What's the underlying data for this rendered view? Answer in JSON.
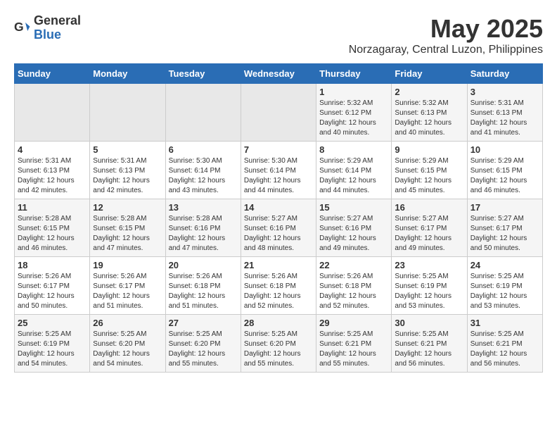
{
  "logo": {
    "general": "General",
    "blue": "Blue"
  },
  "title": "May 2025",
  "subtitle": "Norzagaray, Central Luzon, Philippines",
  "days_of_week": [
    "Sunday",
    "Monday",
    "Tuesday",
    "Wednesday",
    "Thursday",
    "Friday",
    "Saturday"
  ],
  "weeks": [
    [
      {
        "day": "",
        "info": ""
      },
      {
        "day": "",
        "info": ""
      },
      {
        "day": "",
        "info": ""
      },
      {
        "day": "",
        "info": ""
      },
      {
        "day": "1",
        "info": "Sunrise: 5:32 AM\nSunset: 6:12 PM\nDaylight: 12 hours\nand 40 minutes."
      },
      {
        "day": "2",
        "info": "Sunrise: 5:32 AM\nSunset: 6:13 PM\nDaylight: 12 hours\nand 40 minutes."
      },
      {
        "day": "3",
        "info": "Sunrise: 5:31 AM\nSunset: 6:13 PM\nDaylight: 12 hours\nand 41 minutes."
      }
    ],
    [
      {
        "day": "4",
        "info": "Sunrise: 5:31 AM\nSunset: 6:13 PM\nDaylight: 12 hours\nand 42 minutes."
      },
      {
        "day": "5",
        "info": "Sunrise: 5:31 AM\nSunset: 6:13 PM\nDaylight: 12 hours\nand 42 minutes."
      },
      {
        "day": "6",
        "info": "Sunrise: 5:30 AM\nSunset: 6:14 PM\nDaylight: 12 hours\nand 43 minutes."
      },
      {
        "day": "7",
        "info": "Sunrise: 5:30 AM\nSunset: 6:14 PM\nDaylight: 12 hours\nand 44 minutes."
      },
      {
        "day": "8",
        "info": "Sunrise: 5:29 AM\nSunset: 6:14 PM\nDaylight: 12 hours\nand 44 minutes."
      },
      {
        "day": "9",
        "info": "Sunrise: 5:29 AM\nSunset: 6:15 PM\nDaylight: 12 hours\nand 45 minutes."
      },
      {
        "day": "10",
        "info": "Sunrise: 5:29 AM\nSunset: 6:15 PM\nDaylight: 12 hours\nand 46 minutes."
      }
    ],
    [
      {
        "day": "11",
        "info": "Sunrise: 5:28 AM\nSunset: 6:15 PM\nDaylight: 12 hours\nand 46 minutes."
      },
      {
        "day": "12",
        "info": "Sunrise: 5:28 AM\nSunset: 6:15 PM\nDaylight: 12 hours\nand 47 minutes."
      },
      {
        "day": "13",
        "info": "Sunrise: 5:28 AM\nSunset: 6:16 PM\nDaylight: 12 hours\nand 47 minutes."
      },
      {
        "day": "14",
        "info": "Sunrise: 5:27 AM\nSunset: 6:16 PM\nDaylight: 12 hours\nand 48 minutes."
      },
      {
        "day": "15",
        "info": "Sunrise: 5:27 AM\nSunset: 6:16 PM\nDaylight: 12 hours\nand 49 minutes."
      },
      {
        "day": "16",
        "info": "Sunrise: 5:27 AM\nSunset: 6:17 PM\nDaylight: 12 hours\nand 49 minutes."
      },
      {
        "day": "17",
        "info": "Sunrise: 5:27 AM\nSunset: 6:17 PM\nDaylight: 12 hours\nand 50 minutes."
      }
    ],
    [
      {
        "day": "18",
        "info": "Sunrise: 5:26 AM\nSunset: 6:17 PM\nDaylight: 12 hours\nand 50 minutes."
      },
      {
        "day": "19",
        "info": "Sunrise: 5:26 AM\nSunset: 6:17 PM\nDaylight: 12 hours\nand 51 minutes."
      },
      {
        "day": "20",
        "info": "Sunrise: 5:26 AM\nSunset: 6:18 PM\nDaylight: 12 hours\nand 51 minutes."
      },
      {
        "day": "21",
        "info": "Sunrise: 5:26 AM\nSunset: 6:18 PM\nDaylight: 12 hours\nand 52 minutes."
      },
      {
        "day": "22",
        "info": "Sunrise: 5:26 AM\nSunset: 6:18 PM\nDaylight: 12 hours\nand 52 minutes."
      },
      {
        "day": "23",
        "info": "Sunrise: 5:25 AM\nSunset: 6:19 PM\nDaylight: 12 hours\nand 53 minutes."
      },
      {
        "day": "24",
        "info": "Sunrise: 5:25 AM\nSunset: 6:19 PM\nDaylight: 12 hours\nand 53 minutes."
      }
    ],
    [
      {
        "day": "25",
        "info": "Sunrise: 5:25 AM\nSunset: 6:19 PM\nDaylight: 12 hours\nand 54 minutes."
      },
      {
        "day": "26",
        "info": "Sunrise: 5:25 AM\nSunset: 6:20 PM\nDaylight: 12 hours\nand 54 minutes."
      },
      {
        "day": "27",
        "info": "Sunrise: 5:25 AM\nSunset: 6:20 PM\nDaylight: 12 hours\nand 55 minutes."
      },
      {
        "day": "28",
        "info": "Sunrise: 5:25 AM\nSunset: 6:20 PM\nDaylight: 12 hours\nand 55 minutes."
      },
      {
        "day": "29",
        "info": "Sunrise: 5:25 AM\nSunset: 6:21 PM\nDaylight: 12 hours\nand 55 minutes."
      },
      {
        "day": "30",
        "info": "Sunrise: 5:25 AM\nSunset: 6:21 PM\nDaylight: 12 hours\nand 56 minutes."
      },
      {
        "day": "31",
        "info": "Sunrise: 5:25 AM\nSunset: 6:21 PM\nDaylight: 12 hours\nand 56 minutes."
      }
    ]
  ]
}
